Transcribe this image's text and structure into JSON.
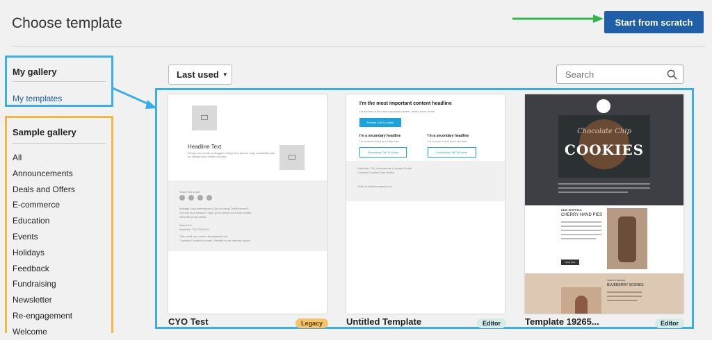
{
  "header": {
    "title": "Choose template",
    "start_button": "Start from scratch"
  },
  "my_gallery": {
    "heading": "My gallery",
    "item": "My templates"
  },
  "sample_gallery": {
    "heading": "Sample gallery",
    "items": [
      "All",
      "Announcements",
      "Deals and Offers",
      "E-commerce",
      "Education",
      "Events",
      "Holidays",
      "Feedback",
      "Fundraising",
      "Newsletter",
      "Re-engagement",
      "Welcome"
    ]
  },
  "toolbar": {
    "sort_label": "Last used",
    "search_placeholder": "Search"
  },
  "cards": [
    {
      "name": "CYO Test",
      "badge": "Legacy",
      "preview": {
        "headline": "Headline Text",
        "body": "Design new email on stagged a large font size for easy readability both on desktop and mobile devices",
        "share": "Share this email:",
        "footer_lines": [
          "Manage your preferences | Opt out using TrueRemove®",
          "Got this as a forward? Sign up to receive our future emails.",
          "View this email online.",
          "Street line",
          "Nashville, TN 37203 US",
          "This email was sent to abc@gmail.com",
          "Constant Contact by email, Website is our address above."
        ]
      }
    },
    {
      "name": "Untitled Template",
      "badge": "Editor",
      "preview": {
        "headline": "I'm the most important content headline",
        "subtext": "I'm the text of the most important content. Here's more of me!",
        "primary_cta": "Primary Call To Action",
        "secondary_headline": "I'm a secondary headline",
        "secondary_text": "I'm a block of text and I like tabs",
        "secondary_cta": "Secondary Call To Action",
        "footer_lines": [
          "Nashville, TN | Unsubscribe | Update Profile",
          "Constant Contact Data Notice",
          "Sent by info@company.com"
        ]
      }
    },
    {
      "name": "Template 19265...",
      "badge": "Editor",
      "preview": {
        "script_title": "Chocolate Chip",
        "hero_title": "COOKIES",
        "item1_tag": "NEW SHIPPING",
        "item1_title": "CHERRY HAND PIES",
        "item1_button": "Shop Now",
        "item2_tag": "TODAY'S SPECIAL",
        "item2_title": "BLUEBERRY SCONES"
      }
    }
  ]
}
